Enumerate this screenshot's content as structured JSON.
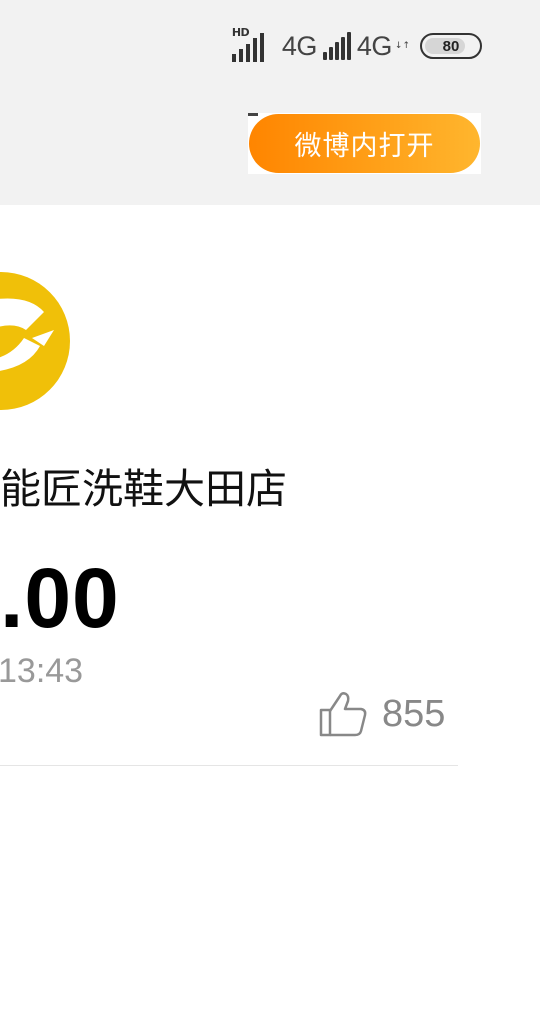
{
  "status_bar": {
    "hd_label": "HD",
    "network_1": "4G",
    "network_2": "4G",
    "network_2_activity": "↓↑",
    "battery_level": "80",
    "battery_fraction": 0.8
  },
  "header": {
    "open_button_label": "微博内打开",
    "open_button_colors": [
      "#ff8500",
      "#ffb62e"
    ]
  },
  "content": {
    "avatar_color": "#f0c009",
    "merchant_name": "能匠洗鞋大田店",
    "amount": ".00",
    "time": "13:43",
    "like_count": "855",
    "like_icon": "thumbs-up-icon"
  }
}
